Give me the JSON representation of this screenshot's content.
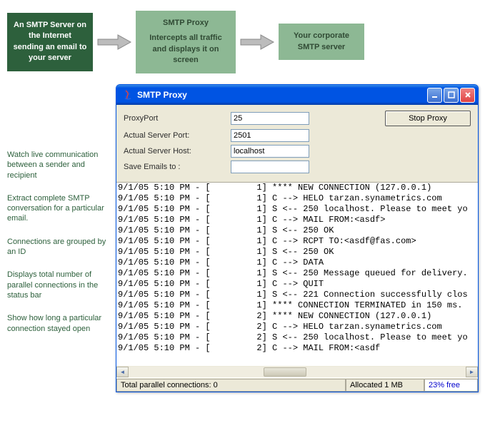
{
  "flow": {
    "box1": "An SMTP Server on the Internet sending an email to your server",
    "box2_title": "SMTP Proxy",
    "box2_body": "Intercepts all traffic and displays it on screen",
    "box3": "Your corporate SMTP server"
  },
  "notes": {
    "n1": "Watch live communication between a sender and recipient",
    "n2": "Extract complete SMTP conversation for a particular email.",
    "n3": "Connections are grouped by an ID",
    "n4": "Displays total number of parallel connections in the status bar",
    "n5": "Show how long a particular connection stayed open"
  },
  "window": {
    "title": "SMTP Proxy"
  },
  "form": {
    "proxyPortLabel": "ProxyPort",
    "proxyPortValue": "25",
    "actualServerPortLabel": "Actual Server Port:",
    "actualServerPortValue": "2501",
    "actualServerHostLabel": "Actual Server Host:",
    "actualServerHostValue": "localhost",
    "saveEmailsLabel": "Save Emails to :",
    "saveEmailsValue": "",
    "stopBtn": "Stop Proxy"
  },
  "log": "9/1/05 5:10 PM - [         1] **** NEW CONNECTION (127.0.0.1)\n9/1/05 5:10 PM - [         1] C --> HELO tarzan.synametrics.com\n9/1/05 5:10 PM - [         1] S <-- 250 localhost. Please to meet yo\n9/1/05 5:10 PM - [         1] C --> MAIL FROM:<asdf>\n9/1/05 5:10 PM - [         1] S <-- 250 OK\n9/1/05 5:10 PM - [         1] C --> RCPT TO:<asdf@fas.com>\n9/1/05 5:10 PM - [         1] S <-- 250 OK\n9/1/05 5:10 PM - [         1] C --> DATA\n9/1/05 5:10 PM - [         1] S <-- 250 Message queued for delivery.\n9/1/05 5:10 PM - [         1] C --> QUIT\n9/1/05 5:10 PM - [         1] S <-- 221 Connection successfully clos\n9/1/05 5:10 PM - [         1] **** CONNECTION TERMINATED in 150 ms.\n9/1/05 5:10 PM - [         2] **** NEW CONNECTION (127.0.0.1)\n9/1/05 5:10 PM - [         2] C --> HELO tarzan.synametrics.com\n9/1/05 5:10 PM - [         2] S <-- 250 localhost. Please to meet yo\n9/1/05 5:10 PM - [         2] C --> MAIL FROM:<asdf",
  "status": {
    "parallel": "Total parallel connections: 0",
    "allocated": "Allocated 1 MB",
    "free": "23% free"
  }
}
